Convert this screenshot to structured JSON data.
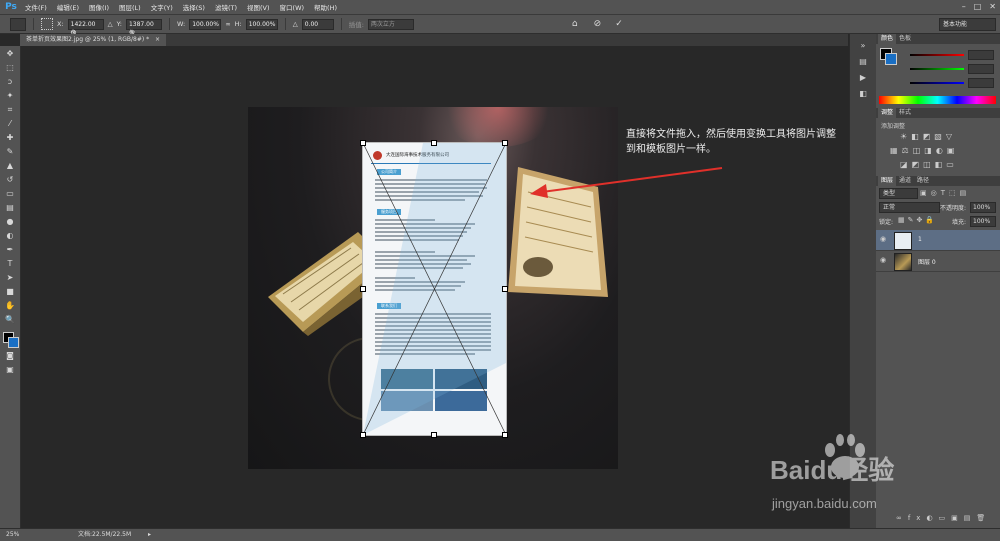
{
  "menubar": {
    "logo": "Ps",
    "items": [
      "文件(F)",
      "编辑(E)",
      "图像(I)",
      "图层(L)",
      "文字(Y)",
      "选择(S)",
      "滤镜(T)",
      "视图(V)",
      "窗口(W)",
      "帮助(H)"
    ],
    "window_controls": [
      "–",
      "□",
      "✕"
    ]
  },
  "options": {
    "x_label": "X:",
    "x_value": "1422.00 像",
    "y_label": "Y:",
    "y_value": "1387.00 像",
    "w_label": "W:",
    "w_value": "100.00%",
    "h_label": "H:",
    "h_value": "100.00%",
    "angle_label": "△",
    "angle_value": "0.00",
    "interp_label": "插值:",
    "interp_value": "两次立方",
    "workspace": "基本功能"
  },
  "tab": {
    "label": "茶单折页效果图2.jpg @ 25% (1, RGB/8#) *"
  },
  "annotation": {
    "text": "直接将文件拖入，然后使用变换工具将图片调整到和模板图片一样。"
  },
  "placed_doc": {
    "company": "大连国际海事技术服务有限公司",
    "sections": [
      "公司简介",
      "服务项目",
      "联系我们"
    ]
  },
  "panels": {
    "color_tabs": [
      "颜色",
      "色板"
    ],
    "adjust_tabs": [
      "调整",
      "样式"
    ],
    "adjust_title": "添加调整",
    "layer_tabs": [
      "图层",
      "通道",
      "路径"
    ],
    "kind_label": "类型",
    "blend_mode": "正常",
    "opacity_label": "不透明度:",
    "opacity_value": "100%",
    "lock_label": "锁定:",
    "fill_label": "填充:",
    "fill_value": "100%",
    "layers": [
      {
        "name": "1"
      },
      {
        "name": "图层 0"
      }
    ]
  },
  "status": {
    "zoom": "25%",
    "doc_info": "文档:22.5M/22.5M"
  },
  "watermark": {
    "brand": "Baidu经验",
    "url": "jingyan.baidu.com"
  },
  "colors": {
    "accent": "#3fa9f5",
    "arrow": "#e0302a",
    "ui_bg": "#535353",
    "canvas_bg": "#282828"
  }
}
